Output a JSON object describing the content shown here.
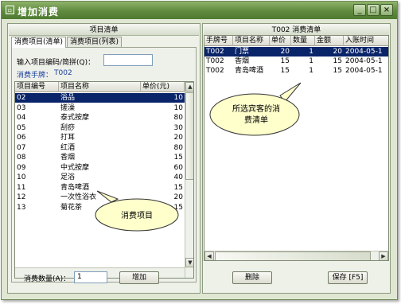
{
  "window": {
    "title": "增加消费",
    "minimize_icon": "minimize-icon",
    "maximize_icon": "maximize-icon",
    "close_icon": "close-icon"
  },
  "left_panel": {
    "header": "项目清单",
    "tabs": [
      "消费项目(清单)",
      "消费项目(列表)"
    ],
    "search_label": "输入项目编码/简拼(Q)：",
    "search_value": "",
    "hand_plate_label": "消费手牌：",
    "hand_plate_value": "T002",
    "columns": [
      "项目编号",
      "项目名称",
      "单价(元)"
    ],
    "rows": [
      {
        "code": "02",
        "name": "浴品",
        "price": "10"
      },
      {
        "code": "03",
        "name": "搓澡",
        "price": "10"
      },
      {
        "code": "04",
        "name": "泰式按摩",
        "price": "80"
      },
      {
        "code": "05",
        "name": "刮痧",
        "price": "30"
      },
      {
        "code": "06",
        "name": "打耳",
        "price": "20"
      },
      {
        "code": "07",
        "name": "红酒",
        "price": "80"
      },
      {
        "code": "08",
        "name": "香烟",
        "price": "15"
      },
      {
        "code": "09",
        "name": "中式按摩",
        "price": "60"
      },
      {
        "code": "10",
        "name": "足浴",
        "price": "40"
      },
      {
        "code": "11",
        "name": "青岛啤酒",
        "price": "15"
      },
      {
        "code": "12",
        "name": "一次性浴衣",
        "price": "20"
      },
      {
        "code": "13",
        "name": "菊花茶",
        "price": "15"
      }
    ],
    "selected_row": 0,
    "callout_text": "消费项目",
    "qty_label": "消费数量(A)：",
    "qty_value": "1",
    "add_button": "增加"
  },
  "right_panel": {
    "header": "T002 消费清单",
    "columns": [
      "手牌号",
      "项目名称",
      "单价",
      "数量",
      "金额",
      "入账时间"
    ],
    "rows": [
      {
        "plate": "T002",
        "name": "门票",
        "price": "20",
        "qty": "1",
        "amount": "20",
        "time": "2004-05-1"
      },
      {
        "plate": "T002",
        "name": "香烟",
        "price": "15",
        "qty": "1",
        "amount": "15",
        "time": "2004-05-1"
      },
      {
        "plate": "T002",
        "name": "青岛啤酒",
        "price": "15",
        "qty": "1",
        "amount": "15",
        "time": "2004-05-1"
      }
    ],
    "selected_row": 0,
    "callout_text": "所选宾客的消费清单",
    "delete_button": "删除",
    "save_button": "保存 [F5]"
  }
}
